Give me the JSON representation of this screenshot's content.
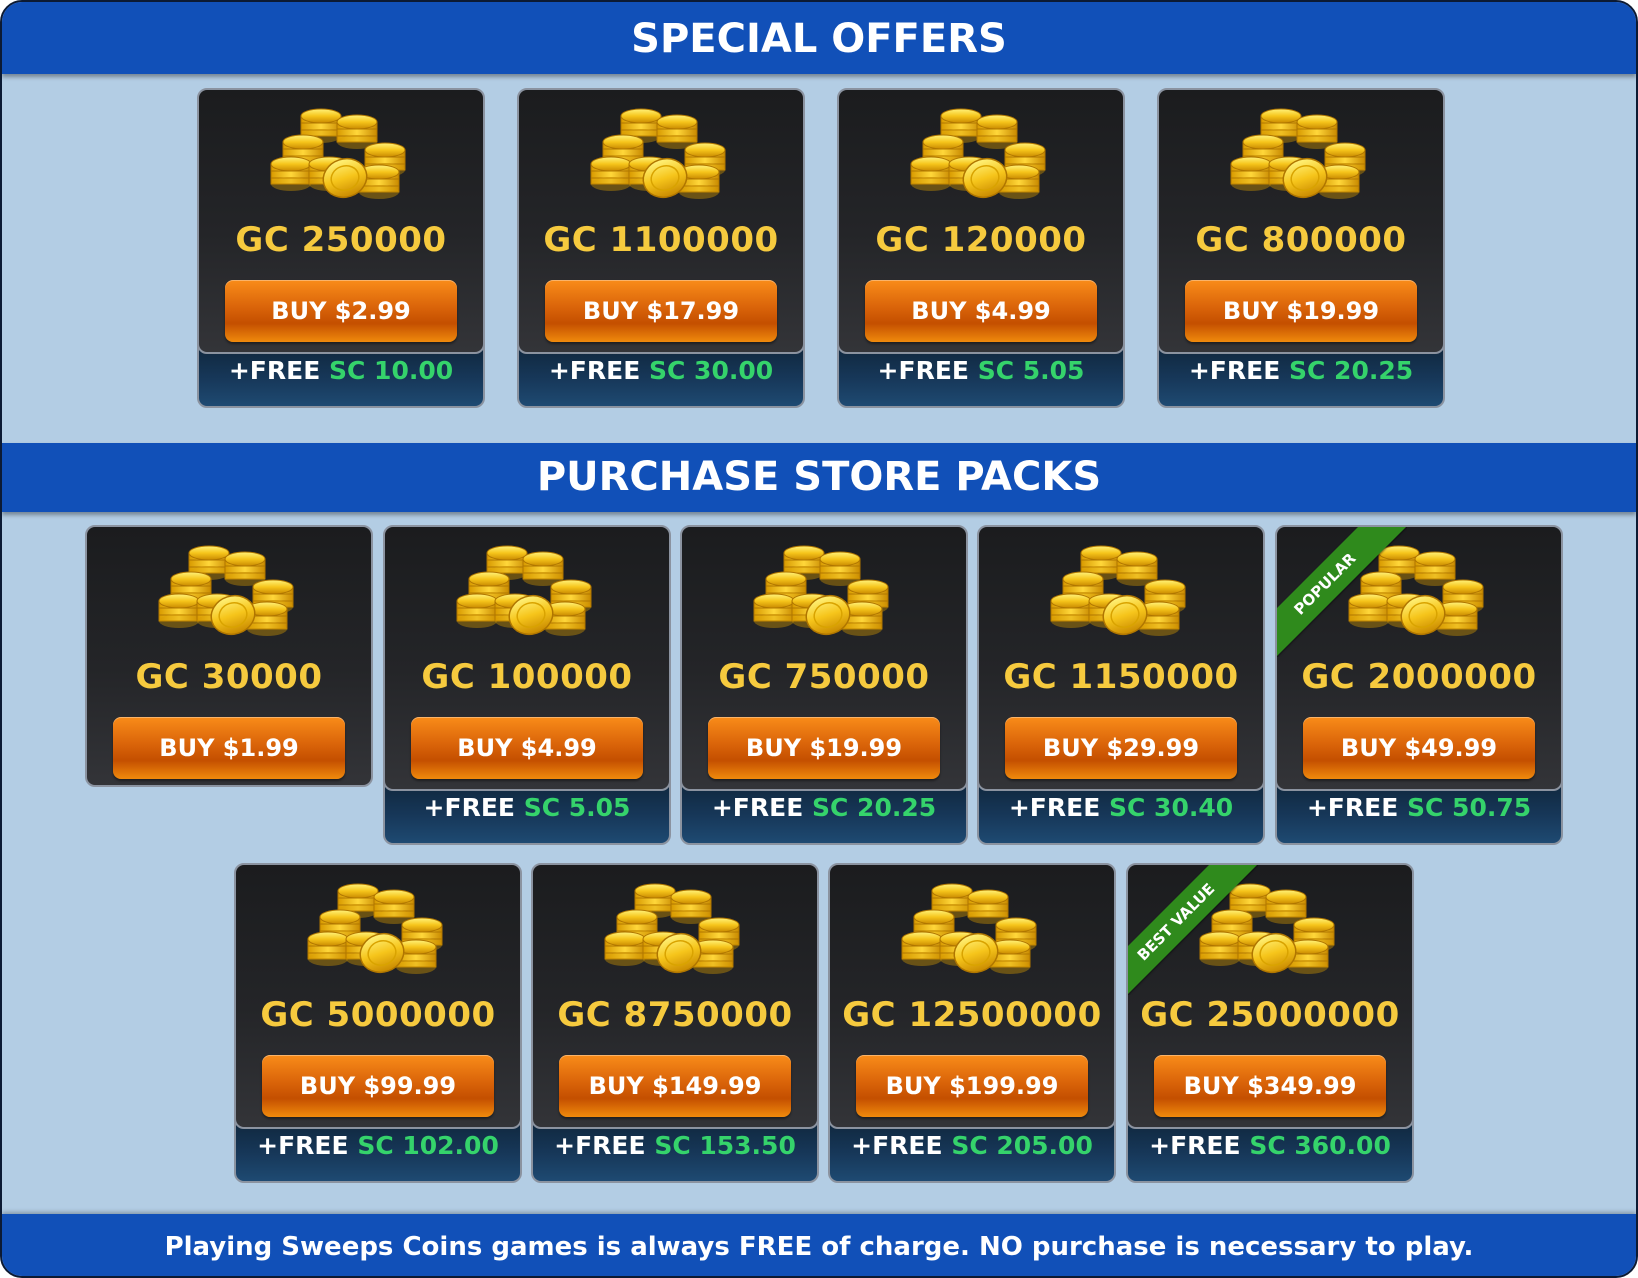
{
  "banners": {
    "special_offers": "SPECIAL OFFERS",
    "store_packs": "PURCHASE STORE PACKS",
    "footer": "Playing Sweeps Coins games is always FREE of charge. NO purchase is necessary to play."
  },
  "colors": {
    "banner": "#1150b8",
    "background": "#b3cde4",
    "gold_text": "#f6ca3e",
    "buy_button": "#e06a0a",
    "sc_text": "#35d36b",
    "ribbon": "#2f8a1c"
  },
  "special_offers": [
    {
      "gc": "GC 250000",
      "buy": "BUY $2.99",
      "free_prefix": "+FREE",
      "sc": "SC 10.00"
    },
    {
      "gc": "GC 1100000",
      "buy": "BUY $17.99",
      "free_prefix": "+FREE",
      "sc": "SC 30.00"
    },
    {
      "gc": "GC 120000",
      "buy": "BUY $4.99",
      "free_prefix": "+FREE",
      "sc": "SC 5.05"
    },
    {
      "gc": "GC 800000",
      "buy": "BUY $19.99",
      "free_prefix": "+FREE",
      "sc": "SC 20.25"
    }
  ],
  "store_packs": [
    {
      "gc": "GC 30000",
      "buy": "BUY $1.99"
    },
    {
      "gc": "GC 100000",
      "buy": "BUY $4.99",
      "free_prefix": "+FREE",
      "sc": "SC 5.05"
    },
    {
      "gc": "GC 750000",
      "buy": "BUY $19.99",
      "free_prefix": "+FREE",
      "sc": "SC 20.25"
    },
    {
      "gc": "GC 1150000",
      "buy": "BUY $29.99",
      "free_prefix": "+FREE",
      "sc": "SC 30.40"
    },
    {
      "gc": "GC 2000000",
      "buy": "BUY $49.99",
      "free_prefix": "+FREE",
      "sc": "SC 50.75",
      "ribbon": "POPULAR"
    },
    {
      "gc": "GC 5000000",
      "buy": "BUY $99.99",
      "free_prefix": "+FREE",
      "sc": "SC 102.00"
    },
    {
      "gc": "GC 8750000",
      "buy": "BUY $149.99",
      "free_prefix": "+FREE",
      "sc": "SC 153.50"
    },
    {
      "gc": "GC 12500000",
      "buy": "BUY $199.99",
      "free_prefix": "+FREE",
      "sc": "SC 205.00"
    },
    {
      "gc": "GC 25000000",
      "buy": "BUY $349.99",
      "free_prefix": "+FREE",
      "sc": "SC 360.00",
      "ribbon": "BEST VALUE"
    }
  ]
}
